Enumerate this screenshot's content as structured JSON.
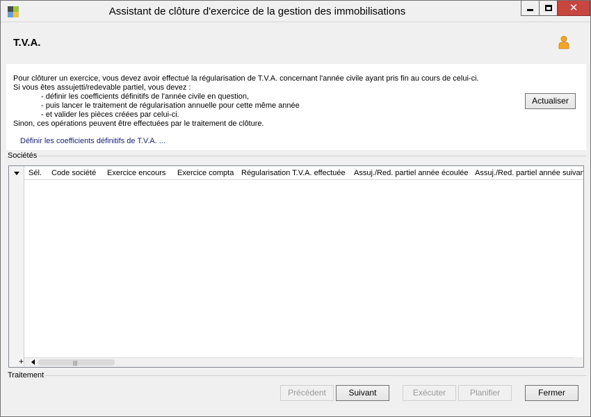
{
  "window": {
    "title": "Assistant de clôture d'exercice de la gestion des immobilisations",
    "icon_colors": [
      "#4a4a4a",
      "#9bc43a",
      "#6d9bd1",
      "#e8c34a"
    ]
  },
  "header": {
    "title": "T.V.A.",
    "icon": "person-icon",
    "icon_color": "#f5a623"
  },
  "info": {
    "lines": [
      "Pour clôturer un exercice, vous devez avoir effectué la régularisation de T.V.A. concernant l'année civile ayant pris fin au cours de celui-ci.",
      "Si vous êtes assujetti/redevable partiel, vous devez :",
      "- définir les coefficients définitifs de l'année civile en question,",
      "- puis lancer le traitement de régularisation annuelle pour cette même année",
      "- et valider les pièces créées par celui-ci.",
      "Sinon, ces opérations peuvent être effectuées par le traitement de clôture."
    ],
    "link": "Définir les coefficients définitifs de T.V.A. ...",
    "refresh_button": "Actualiser"
  },
  "societes": {
    "label": "Sociétés",
    "columns": [
      "Sél.",
      "Code société",
      "Exercice encours",
      "Exercice compta",
      "Régularisation T.V.A. effectuée",
      "Assuj./Red. partiel année écoulée",
      "Assuj./Red. partiel année suivan"
    ],
    "rows": [],
    "add_symbol": "+"
  },
  "traitement": {
    "label": "Traitement"
  },
  "buttons": {
    "previous": "Précédent",
    "next": "Suivant",
    "execute": "Exécuter",
    "schedule": "Planifier",
    "close": "Fermer"
  }
}
